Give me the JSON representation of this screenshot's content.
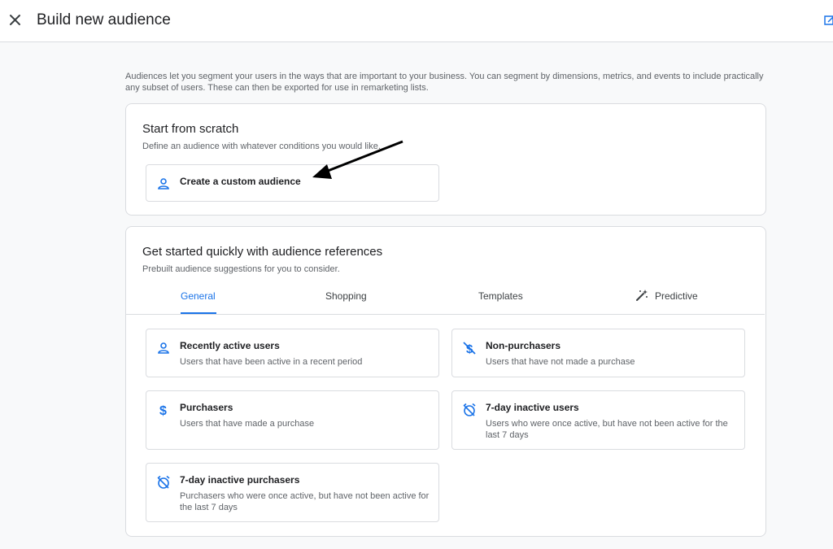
{
  "header": {
    "title": "Build new audience"
  },
  "intro_text": "Audiences let you segment your users in the ways that are important to your business. You can segment by dimensions, metrics, and events to include practically any subset of users. These can then be exported for use in remarketing lists.",
  "scratch": {
    "title": "Start from scratch",
    "subtitle": "Define an audience with whatever conditions you would like.",
    "custom_label": "Create a custom audience"
  },
  "references": {
    "title": "Get started quickly with audience references",
    "subtitle": "Prebuilt audience suggestions for you to consider.",
    "tabs": [
      {
        "label": "General",
        "active": true
      },
      {
        "label": "Shopping",
        "active": false
      },
      {
        "label": "Templates",
        "active": false
      },
      {
        "label": "Predictive",
        "active": false
      }
    ],
    "options": [
      {
        "title": "Recently active users",
        "desc": "Users that have been active in a recent period",
        "icon": "person-icon"
      },
      {
        "title": "Non-purchasers",
        "desc": "Users that have not made a purchase",
        "icon": "no-dollar-icon"
      },
      {
        "title": "Purchasers",
        "desc": "Users that have made a purchase",
        "icon": "dollar-icon"
      },
      {
        "title": "7-day inactive users",
        "desc": "Users who were once active, but have not been active for the last 7 days",
        "icon": "alarm-off-icon"
      },
      {
        "title": "7-day inactive purchasers",
        "desc": "Purchasers who were once active, but have not been active for the last 7 days",
        "icon": "alarm-off-icon"
      }
    ]
  },
  "colors": {
    "accent": "#1a73e8",
    "border": "#dadce0",
    "background": "#f8f9fa"
  }
}
